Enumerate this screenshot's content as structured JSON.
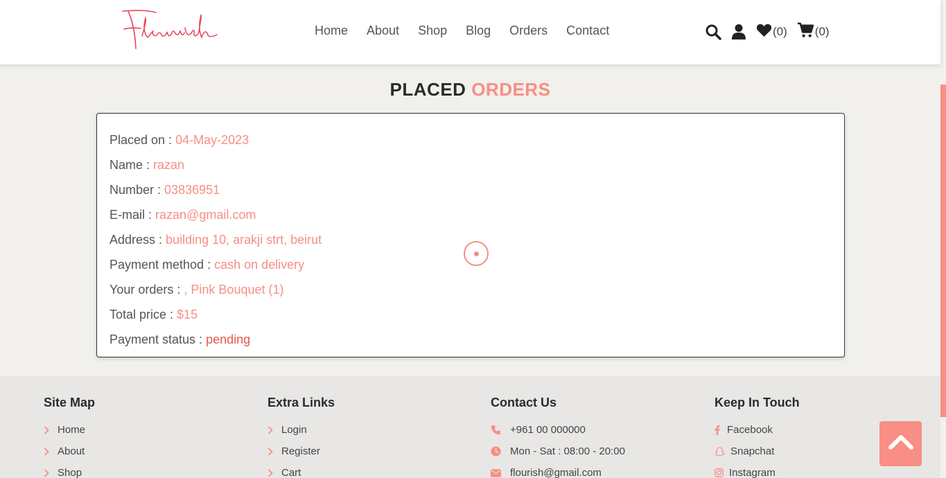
{
  "brand": {
    "logo_text": "Flourish",
    "accent": "#f88e84"
  },
  "nav": {
    "items": [
      "Home",
      "About",
      "Shop",
      "Blog",
      "Orders",
      "Contact"
    ]
  },
  "header_icons": {
    "search": "search-icon",
    "user": "user-icon",
    "wishlist_count": "(0)",
    "cart_count": "(0)"
  },
  "page": {
    "title_part1": "PLACED",
    "title_part2": "ORDERS"
  },
  "order": {
    "placed_on_label": "Placed on : ",
    "placed_on": "04-May-2023",
    "name_label": "Name : ",
    "name": "razan",
    "number_label": "Number : ",
    "number": "03836951",
    "email_label": "E-mail : ",
    "email": "razan@gmail.com",
    "address_label": "Address : ",
    "address": "building 10, arakji strt, beirut",
    "payment_method_label": "Payment method : ",
    "payment_method": "cash on delivery",
    "orders_label": "Your orders : ",
    "orders": ", Pink Bouquet (1)",
    "total_label": "Total price : ",
    "total": "$15",
    "status_label": "Payment status : ",
    "status": "pending"
  },
  "footer": {
    "site_map": {
      "title": "Site Map",
      "items": [
        "Home",
        "About",
        "Shop"
      ]
    },
    "extra_links": {
      "title": "Extra Links",
      "items": [
        "Login",
        "Register",
        "Cart"
      ]
    },
    "contact": {
      "title": "Contact Us",
      "phone": "+961 00 000000",
      "hours": "Mon - Sat : 08:00 - 20:00",
      "email": "flourish@gmail.com"
    },
    "social": {
      "title": "Keep In Touch",
      "items": [
        "Facebook",
        "Snapchat",
        "Instagram"
      ]
    }
  }
}
